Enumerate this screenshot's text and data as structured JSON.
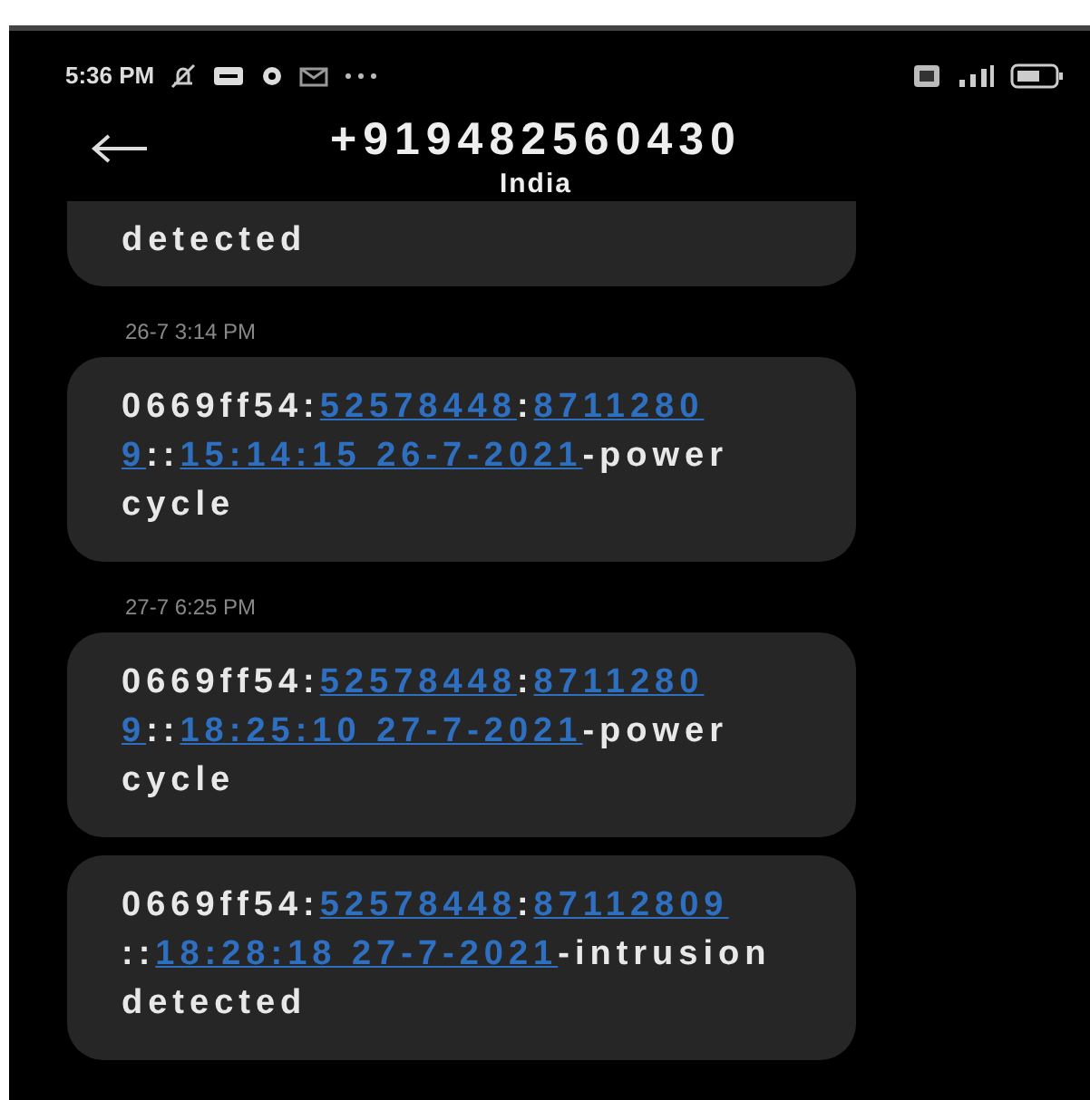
{
  "status_bar": {
    "time": "5:36 PM"
  },
  "header": {
    "title": "+919482560430",
    "subtitle": "India"
  },
  "messages": [
    {
      "kind": "partial",
      "lines": [
        [
          {
            "text": "detected",
            "link": false
          }
        ]
      ]
    },
    {
      "kind": "timestamp",
      "text": "26-7 3:14 PM"
    },
    {
      "kind": "message",
      "lines": [
        [
          {
            "text": "0669ff54:",
            "link": false
          },
          {
            "text": "52578448",
            "link": true
          },
          {
            "text": ":",
            "link": false
          },
          {
            "text": "8711280",
            "link": true
          }
        ],
        [
          {
            "text": "9",
            "link": true
          },
          {
            "text": "::",
            "link": false
          },
          {
            "text": "15:14:15 26-7-2021",
            "link": true
          },
          {
            "text": "-power",
            "link": false
          }
        ],
        [
          {
            "text": "cycle",
            "link": false
          }
        ]
      ]
    },
    {
      "kind": "timestamp",
      "text": "27-7 6:25 PM"
    },
    {
      "kind": "message",
      "lines": [
        [
          {
            "text": "0669ff54:",
            "link": false
          },
          {
            "text": "52578448",
            "link": true
          },
          {
            "text": ":",
            "link": false
          },
          {
            "text": "8711280",
            "link": true
          }
        ],
        [
          {
            "text": "9",
            "link": true
          },
          {
            "text": "::",
            "link": false
          },
          {
            "text": "18:25:10 27-7-2021",
            "link": true
          },
          {
            "text": "-power",
            "link": false
          }
        ],
        [
          {
            "text": "cycle",
            "link": false
          }
        ]
      ]
    },
    {
      "kind": "message",
      "lines": [
        [
          {
            "text": "0669ff54:",
            "link": false
          },
          {
            "text": "52578448",
            "link": true
          },
          {
            "text": ":",
            "link": false
          },
          {
            "text": "87112809",
            "link": true
          }
        ],
        [
          {
            "text": "::",
            "link": false
          },
          {
            "text": "18:28:18 27-7-2021",
            "link": true
          },
          {
            "text": "-intrusion",
            "link": false
          }
        ],
        [
          {
            "text": "detected",
            "link": false
          }
        ]
      ]
    }
  ]
}
